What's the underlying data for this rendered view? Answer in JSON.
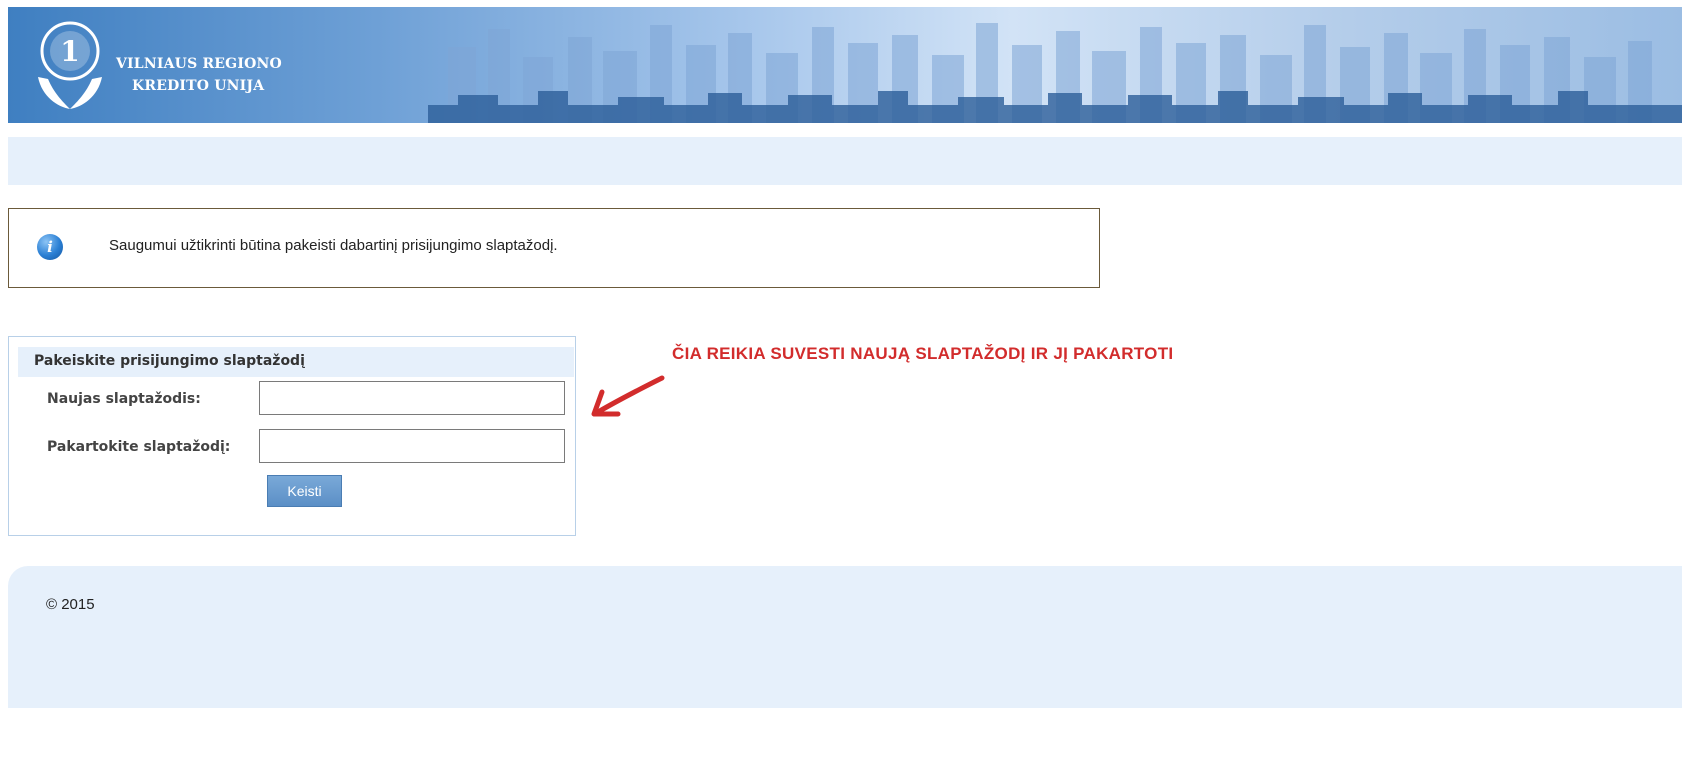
{
  "header": {
    "org_name_line1": "VILNIAUS REGIONO",
    "org_name_line2": "KREDITO UNIJA",
    "logo_numeral": "1"
  },
  "info_message": {
    "icon": "info-icon",
    "icon_glyph": "i",
    "text": "Saugumui užtikrinti būtina pakeisti dabartinį prisijungimo slaptažodį."
  },
  "password_form": {
    "title": "Pakeiskite prisijungimo slaptažodį",
    "new_password_label": "Naujas slaptažodis:",
    "new_password_value": "",
    "repeat_password_label": "Pakartokite slaptažodį:",
    "repeat_password_value": "",
    "submit_label": "Keisti"
  },
  "annotation": {
    "text": "ČIA REIKIA SUVESTI NAUJĄ SLAPTAŽODĮ IR JĮ PAKARTOTI",
    "icon": "arrow-icon"
  },
  "footer": {
    "copyright": "© 2015"
  },
  "colors": {
    "banner_blue": "#3f7fc1",
    "panel_light_blue": "#e6f0fb",
    "button_blue": "#5b8fc6",
    "annotation_red": "#d22c2c",
    "info_border": "#6b5a3a"
  }
}
